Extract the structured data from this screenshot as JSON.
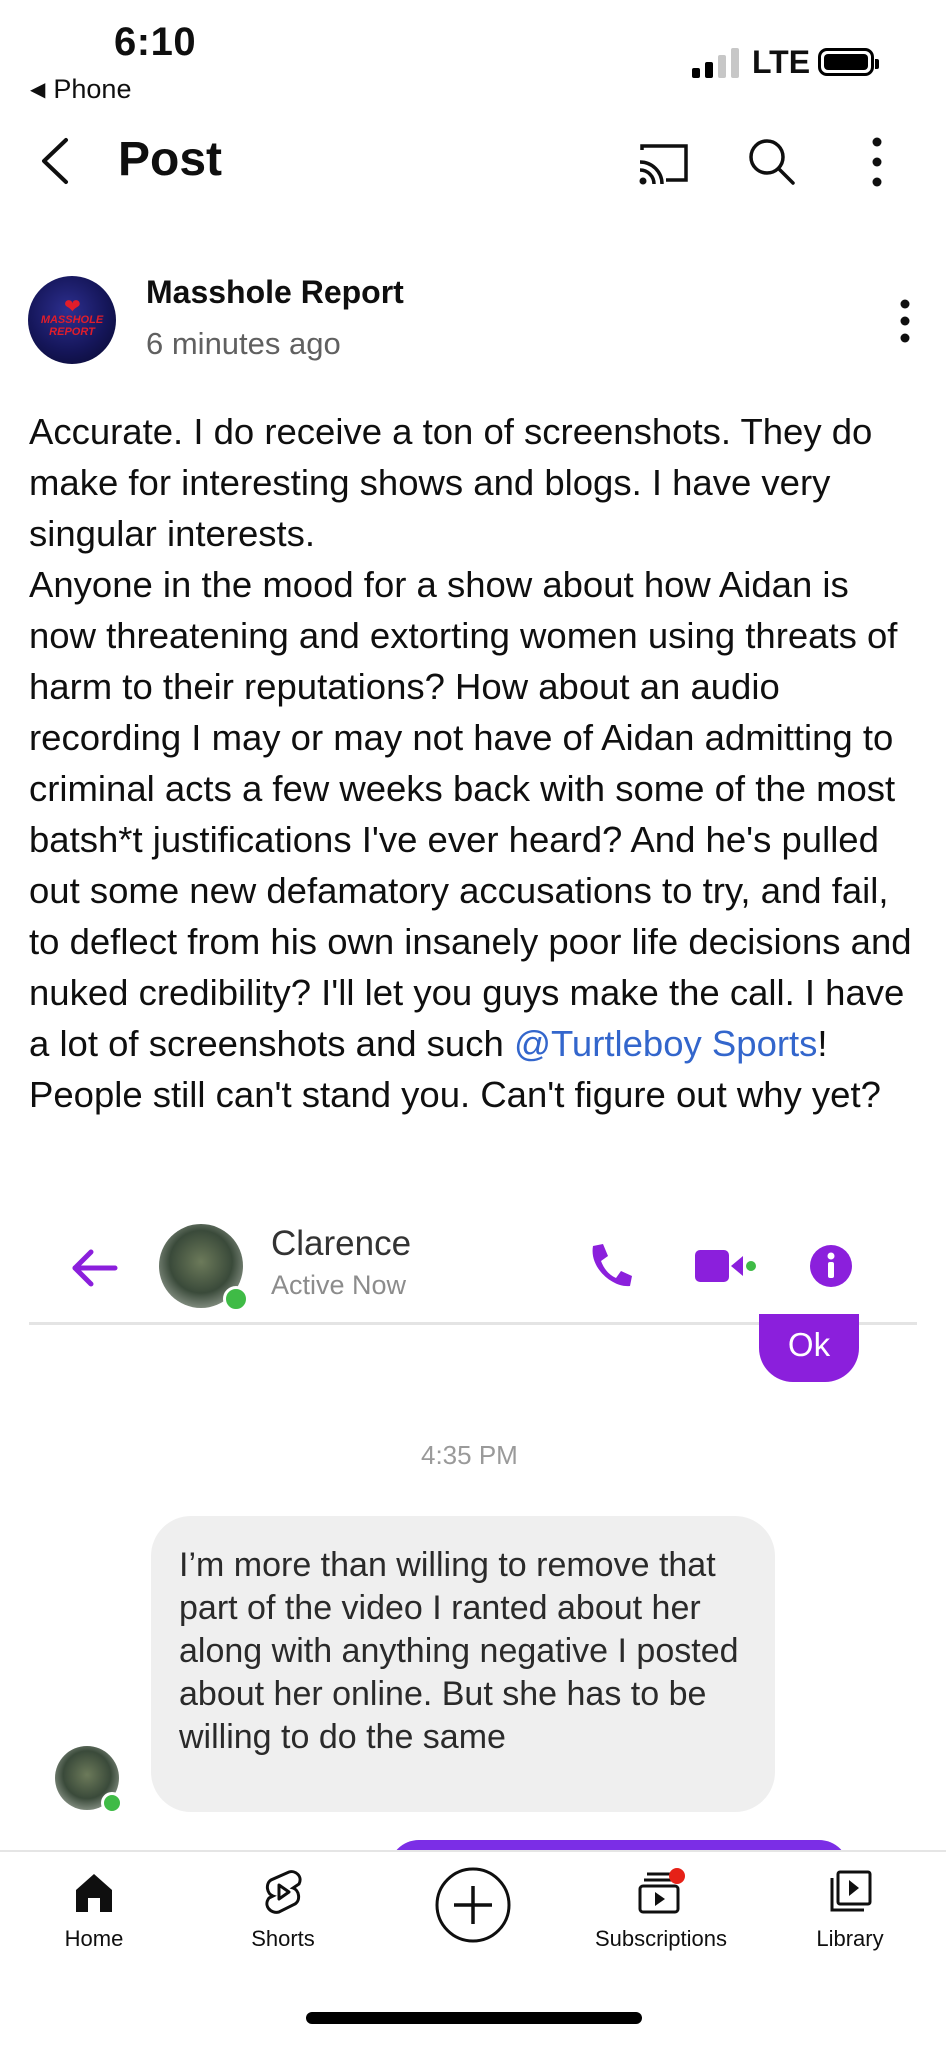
{
  "status_bar": {
    "time": "6:10",
    "back_app": "Phone",
    "network": "LTE"
  },
  "top_bar": {
    "title": "Post"
  },
  "post": {
    "author": "Masshole Report",
    "time_ago": "6 minutes ago",
    "avatar_text": "MASSHOLE REPORT",
    "text_before_mention": "Accurate. I do receive a ton of screenshots. They do make for interesting shows and blogs. I have very singular interests.\nAnyone in the mood for a show about how Aidan is now threatening and extorting women using threats of harm to their reputations? How about an audio recording I may or may not have of Aidan admitting to criminal acts a few weeks back with some of the most batsh*t justifications I've ever heard? And he's pulled out some new defamatory accusations to try, and fail, to deflect from his own insanely poor life decisions and nuked credibility? I'll let you guys make the call. I have a lot of screenshots and such ",
    "mention": "@Turtleboy Sports",
    "text_after_mention": "! People still can't stand you. Can't figure out why yet?",
    "mention_color": "#3366cc"
  },
  "embedded_screenshot": {
    "contact_name": "Clarence",
    "contact_status": "Active Now",
    "ok_message": "Ok",
    "timestamp": "4:35 PM",
    "message": "I’m more than willing to remove that part of the video I ranted about her along with anything negative I posted about her online. But she has to be willing to do the same",
    "accent_color": "#8b1fdc",
    "icons": [
      "back-arrow-icon",
      "phone-icon",
      "video-icon",
      "info-icon"
    ]
  },
  "bottom_nav": {
    "home": "Home",
    "shorts": "Shorts",
    "subscriptions": "Subscriptions",
    "library": "Library"
  },
  "colors": {
    "notification_dot": "#e62117"
  }
}
